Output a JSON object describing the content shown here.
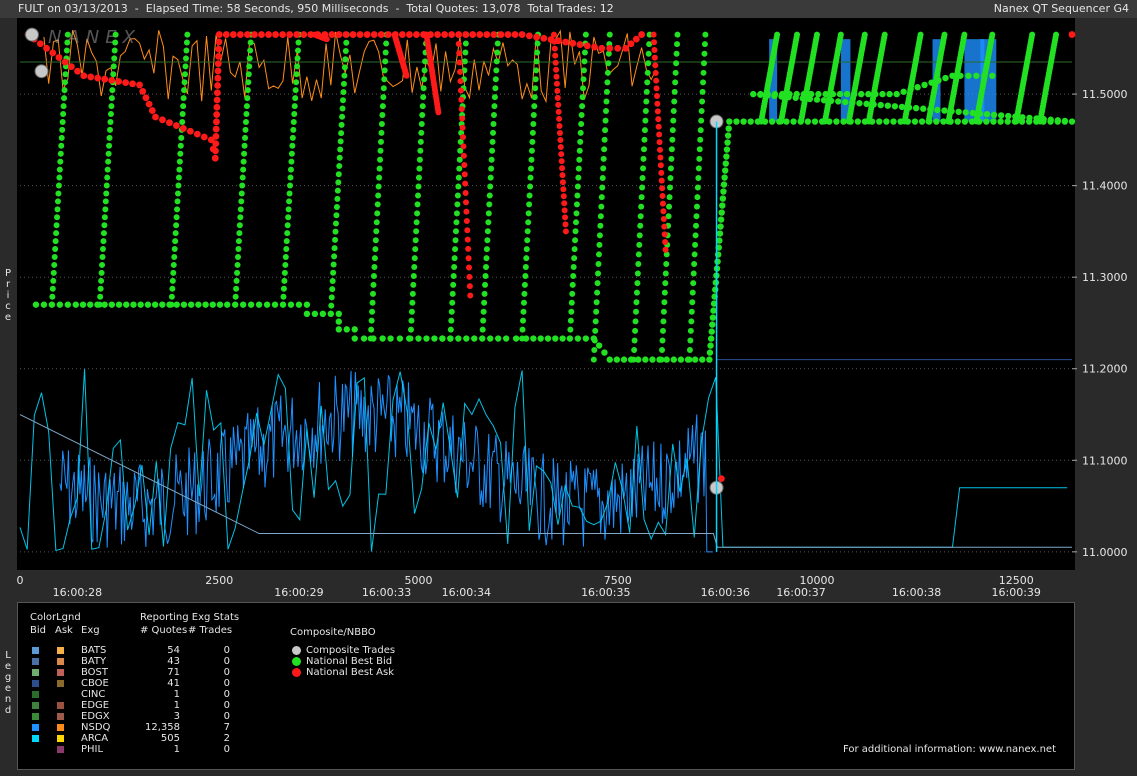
{
  "header": {
    "title": "FULT on 03/13/2013  -  Elapsed Time: 58 Seconds, 950 Milliseconds  -  Total Quotes: 13,078  Total Trades: 12",
    "app_name": "Nanex QT Sequencer G4"
  },
  "watermark": "NANEX",
  "side_labels": {
    "price": "Price",
    "legend": "Legend"
  },
  "chart_data": {
    "type": "line",
    "title": "",
    "ylabel": "Price",
    "ylim": [
      10.99,
      11.57
    ],
    "xlim": [
      0,
      13200
    ],
    "y_ticks": [
      "11.0000",
      "11.1000",
      "11.2000",
      "11.3000",
      "11.4000",
      "11.5000"
    ],
    "x_ticks": [
      "0",
      "2500",
      "5000",
      "7500",
      "10000",
      "12500"
    ],
    "time_labels": [
      {
        "label": "16:00:28",
        "x": 720
      },
      {
        "label": "16:00:29",
        "x": 3500
      },
      {
        "label": "16:00:33",
        "x": 4600
      },
      {
        "label": "16:00:34",
        "x": 5600
      },
      {
        "label": "16:00:35",
        "x": 7350
      },
      {
        "label": "16:00:36",
        "x": 8850
      },
      {
        "label": "16:00:37",
        "x": 9800
      },
      {
        "label": "16:00:38",
        "x": 11250
      },
      {
        "label": "16:00:39",
        "x": 12500
      }
    ],
    "composite_trades": [
      {
        "x": 150,
        "y": 11.565
      },
      {
        "x": 270,
        "y": 11.525
      },
      {
        "x": 8740,
        "y": 11.47
      },
      {
        "x": 8740,
        "y": 11.07
      }
    ],
    "national_best_bid": [
      {
        "x": 200,
        "y": 11.27
      },
      {
        "x": 700,
        "y": 11.27
      },
      {
        "x": 2600,
        "y": 11.27
      },
      {
        "x": 2900,
        "y": 11.27
      },
      {
        "x": 3600,
        "y": 11.27
      },
      {
        "x": 3600,
        "y": 11.26
      },
      {
        "x": 4000,
        "y": 11.26
      },
      {
        "x": 4000,
        "y": 11.243
      },
      {
        "x": 4200,
        "y": 11.243
      },
      {
        "x": 4200,
        "y": 11.233
      },
      {
        "x": 4550,
        "y": 11.233
      },
      {
        "x": 4650,
        "y": 11.233
      },
      {
        "x": 5000,
        "y": 11.233
      },
      {
        "x": 5100,
        "y": 11.233
      },
      {
        "x": 5400,
        "y": 11.233
      },
      {
        "x": 5300,
        "y": 11.233
      },
      {
        "x": 6000,
        "y": 11.233
      },
      {
        "x": 6100,
        "y": 11.233
      },
      {
        "x": 6350,
        "y": 11.233
      },
      {
        "x": 6900,
        "y": 11.233
      },
      {
        "x": 7200,
        "y": 11.233
      },
      {
        "x": 7400,
        "y": 11.21
      },
      {
        "x": 8650,
        "y": 11.21
      },
      {
        "x": 8900,
        "y": 11.47
      },
      {
        "x": 13200,
        "y": 11.47
      },
      {
        "x": 9200,
        "y": 11.5
      },
      {
        "x": 10200,
        "y": 11.5
      },
      {
        "x": 11000,
        "y": 11.5
      },
      {
        "x": 11700,
        "y": 11.52
      },
      {
        "x": 12200,
        "y": 11.52
      }
    ],
    "national_best_ask": [
      {
        "x": 100,
        "y": 11.565
      },
      {
        "x": 800,
        "y": 11.52
      },
      {
        "x": 1500,
        "y": 11.51
      },
      {
        "x": 1700,
        "y": 11.475
      },
      {
        "x": 2400,
        "y": 11.45
      },
      {
        "x": 2450,
        "y": 11.43
      },
      {
        "x": 2500,
        "y": 11.565
      },
      {
        "x": 6300,
        "y": 11.565
      },
      {
        "x": 7300,
        "y": 11.55
      },
      {
        "x": 7600,
        "y": 11.55
      },
      {
        "x": 7800,
        "y": 11.565
      },
      {
        "x": 13200,
        "y": 11.565
      },
      {
        "x": 8800,
        "y": 11.08
      }
    ],
    "grid": true
  },
  "legend": {
    "color_legend_title": "ColorLgnd",
    "stats_title": "Reporting Exg Stats",
    "col_bid": "Bid",
    "col_ask": "Ask",
    "col_exg": "Exg",
    "col_quotes": "# Quotes",
    "col_trades": "# Trades",
    "exchanges": [
      {
        "name": "BATS",
        "quotes": "54",
        "trades": "0",
        "bid_color": "#5b9bd5",
        "ask_color": "#f5b04a"
      },
      {
        "name": "BATY",
        "quotes": "43",
        "trades": "0",
        "bid_color": "#4a6fa5",
        "ask_color": "#d9894a"
      },
      {
        "name": "BOST",
        "quotes": "71",
        "trades": "0",
        "bid_color": "#6fae6f",
        "ask_color": "#c0605a"
      },
      {
        "name": "CBOE",
        "quotes": "41",
        "trades": "0",
        "bid_color": "#2c4e8f",
        "ask_color": "#8a6a2a"
      },
      {
        "name": "CINC",
        "quotes": "1",
        "trades": "0",
        "bid_color": "#2b6b2b",
        "ask_color": ""
      },
      {
        "name": "EDGE",
        "quotes": "1",
        "trades": "0",
        "bid_color": "#3f7f3f",
        "ask_color": "#9b5040"
      },
      {
        "name": "EDGX",
        "quotes": "3",
        "trades": "0",
        "bid_color": "#3a8a3a",
        "ask_color": "#a05a4a"
      },
      {
        "name": "NSDQ",
        "quotes": "12,358",
        "trades": "7",
        "bid_color": "#1e90ff",
        "ask_color": "#ff8c1a"
      },
      {
        "name": "ARCA",
        "quotes": "505",
        "trades": "2",
        "bid_color": "#00d8ff",
        "ask_color": "#ffd700"
      },
      {
        "name": "PHIL",
        "quotes": "1",
        "trades": "0",
        "bid_color": "",
        "ask_color": "#8a3a6a"
      }
    ],
    "composite_title": "Composite/NBBO",
    "composite_items": [
      {
        "label": "Composite Trades",
        "color": "#c8c8c8"
      },
      {
        "label": "National Best Bid",
        "color": "#22e022"
      },
      {
        "label": "National Best Ask",
        "color": "#ff1a1a"
      }
    ],
    "footer": "For additional information: www.nanex.net"
  }
}
